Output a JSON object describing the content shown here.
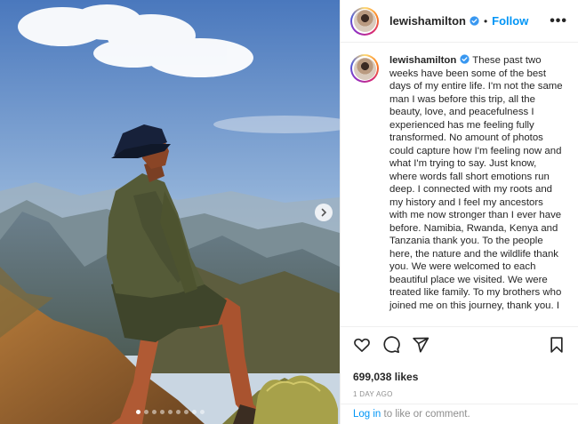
{
  "post": {
    "username": "lewishamilton",
    "follow_label": "Follow",
    "separator": "•",
    "more_label": "•••",
    "caption": "These past two weeks have been some of the best days of my entire life. I'm not the same man I was before this trip, all the beauty, love, and peacefulness I experienced has me feeling fully transformed. No amount of photos could capture how I'm feeling now and what I'm trying to say. Just know, where words fall short emotions run deep. I connected with my roots and my history and I feel my ancestors with me now stronger than I ever have before. Namibia, Rwanda, Kenya and Tanzania thank you. To the people here, the nature and the wildlife thank you. We were welcomed to each beautiful place we visited. We were treated like family. To my brothers who joined me on this journey, thank you. I",
    "likes": "699,038 likes",
    "date": "1 DAY AGO",
    "login_link": "Log in",
    "login_suffix": " to like or comment."
  },
  "carousel": {
    "dot_count": 9,
    "active_index": 0
  },
  "icons": {
    "like": "heart-icon",
    "comment": "comment-icon",
    "share": "share-icon",
    "save": "bookmark-icon",
    "verified": "verified-badge-icon",
    "next": "chevron-right-icon"
  },
  "colors": {
    "accent": "#0095f6",
    "verified": "#3897f0",
    "secondary_text": "#8e8e8e"
  }
}
